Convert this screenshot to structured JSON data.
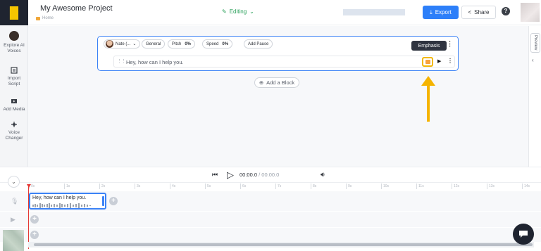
{
  "header": {
    "project_title": "My Awesome Project",
    "breadcrumb": "Home",
    "mode": "Editing",
    "export_label": "Export",
    "share_label": "Share",
    "help_label": "?"
  },
  "sidebar": {
    "items": [
      {
        "label1": "Explore AI",
        "label2": "Voices",
        "icon": "avatar-icon"
      },
      {
        "label1": "Import",
        "label2": "Script",
        "icon": "import-icon"
      },
      {
        "label1": "Add Media",
        "label2": "",
        "icon": "media-icon"
      },
      {
        "label1": "Voice",
        "label2": "Changer",
        "icon": "voice-changer-icon"
      }
    ]
  },
  "block": {
    "voice": "Nate (...",
    "style": "General",
    "pitch_label": "Pitch",
    "pitch_value": "0%",
    "speed_label": "Speed",
    "speed_value": "0%",
    "add_pause": "Add Pause",
    "text": "Hey, how can I help you.",
    "tooltip": "Emphasis"
  },
  "add_block_label": "Add a Block",
  "preview_label": "Preview",
  "player": {
    "current": "00:00.0",
    "separator": " / ",
    "total": "00:00.0"
  },
  "timeline": {
    "ticks": [
      "0s",
      "1s",
      "2s",
      "3s",
      "4s",
      "5s",
      "6s",
      "7s",
      "8s",
      "9s",
      "10s",
      "11s",
      "12s",
      "13s",
      "14s"
    ],
    "clip_text": "Hey, how can I help you."
  },
  "colors": {
    "accent": "#2d7ff9",
    "highlight": "#f2b705",
    "editing": "#2aa05a",
    "playhead": "#e53935"
  }
}
